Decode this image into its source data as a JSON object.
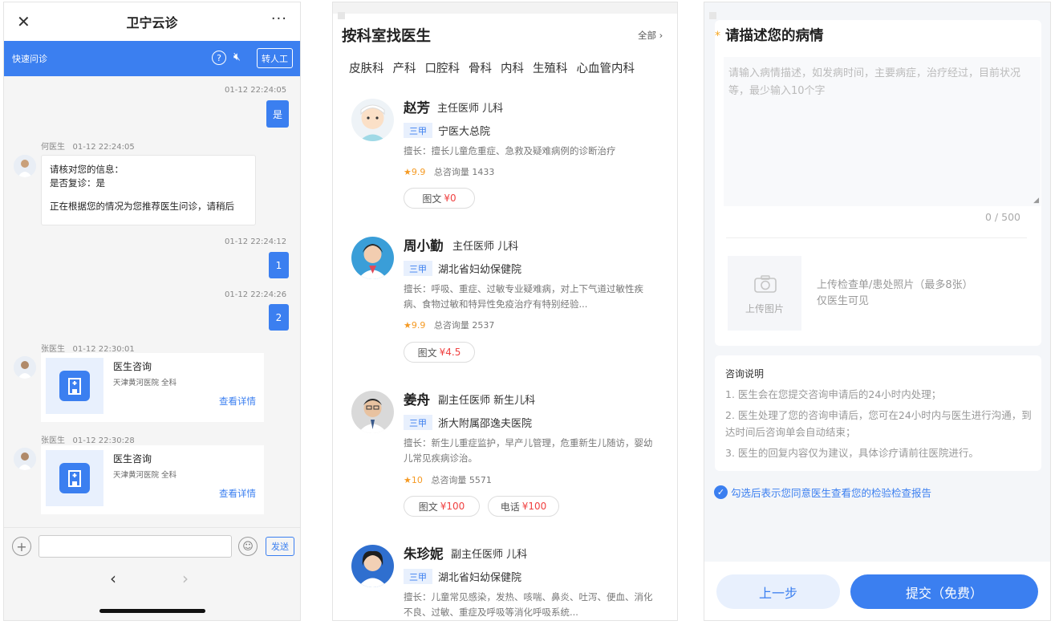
{
  "chat": {
    "title": "卫宁云诊",
    "close_icon": "close-icon",
    "more_icon": "more-icon",
    "quick_label": "快速问诊",
    "help_icon": "help-icon",
    "mute_icon": "mute-icon",
    "transfer_label": "转人工",
    "messages": [
      {
        "time": "01-12 22:24:05",
        "text": "是"
      },
      {
        "sender": "何医生",
        "time": "01-12 22:24:05",
        "lines": [
          "请核对您的信息：",
          "是否复诊：是",
          "",
          "正在根据您的情况为您推荐医生问诊，请稍后"
        ]
      },
      {
        "time": "01-12 22:24:12",
        "text": "1"
      },
      {
        "time": "01-12 22:24:26",
        "text": "2"
      },
      {
        "sender": "张医生",
        "time": "01-12 22:30:01",
        "card_title": "医生咨询",
        "card_sub": "天津黄河医院 全科",
        "card_link": "查看详情"
      },
      {
        "sender": "张医生",
        "time": "01-12 22:30:28",
        "card_title": "医生咨询",
        "card_sub": "天津黄河医院 全科",
        "card_link": "查看详情"
      }
    ],
    "send_label": "发送",
    "nav_back": "‹",
    "nav_forward": "›"
  },
  "doctors_page": {
    "heading": "按科室找医生",
    "all_label": "全部 ›",
    "departments": [
      "皮肤科",
      "产科",
      "口腔科",
      "骨科",
      "内科",
      "生殖科",
      "心血管内科"
    ],
    "doctors": [
      {
        "name": "赵芳",
        "title": "主任医师  儿科",
        "tier": "三甲",
        "hospital": "宁医大总院",
        "specialty": "擅长：擅长儿童危重症、急救及疑难病例的诊断治疗",
        "score": "9.9",
        "consults": "总咨询量 1433",
        "services": [
          {
            "label": "图文",
            "price": "¥0"
          }
        ]
      },
      {
        "name": "周小勤",
        "title": "主任医师  儿科",
        "tier": "三甲",
        "hospital": "湖北省妇幼保健院",
        "specialty": "擅长：呼吸、重症、过敏专业疑难病，对上下气道过敏性疾病、食物过敏和特异性免疫治疗有特别经验...",
        "score": "9.9",
        "consults": "总咨询量 2537",
        "services": [
          {
            "label": "图文",
            "price": "¥4.5"
          }
        ]
      },
      {
        "name": "姜舟",
        "title": "副主任医师  新生儿科",
        "tier": "三甲",
        "hospital": "浙大附属邵逸夫医院",
        "specialty": "擅长：新生儿重症监护，早产儿管理，危重新生儿随访，婴幼儿常见疾病诊治。",
        "score": "10",
        "consults": "总咨询量 5571",
        "services": [
          {
            "label": "图文",
            "price": "¥100"
          },
          {
            "label": "电话",
            "price": "¥100"
          }
        ]
      },
      {
        "name": "朱珍妮",
        "title": "副主任医师  儿科",
        "tier": "三甲",
        "hospital": "湖北省妇幼保健院",
        "specialty": "擅长：儿童常见感染，发热、咳喘、鼻炎、吐泻、便血、消化不良、过敏、重症及呼吸等消化呼吸系统...",
        "score": "",
        "consults": "",
        "services": []
      }
    ]
  },
  "describe_page": {
    "required_mark": "*",
    "title": "请描述您的病情",
    "placeholder": "请输入病情描述，如发病时间，主要病症，治疗经过，目前状况等，最少输入10个字",
    "counter": "0 / 500",
    "upload_label": "上传图片",
    "upload_hint": "上传检查单/患处照片（最多8张）",
    "upload_visibility": "仅医生可见",
    "notes_title": "咨询说明",
    "notes": [
      "1. 医生会在您提交咨询申请后的24小时内处理；",
      "2. 医生处理了您的咨询申请后，您可在24小时内与医生进行沟通，到达时间后咨询单会自动结束；",
      "3. 医生的回复内容仅为建议，具体诊疗请前往医院进行。"
    ],
    "agree_text": "勾选后表示您同意医生查看您的检验检查报告",
    "prev_label": "上一步",
    "submit_label": "提交（免费）"
  },
  "colors": {
    "primary": "#3b7ff0",
    "price_red": "#f04141",
    "star": "#f59a23"
  }
}
